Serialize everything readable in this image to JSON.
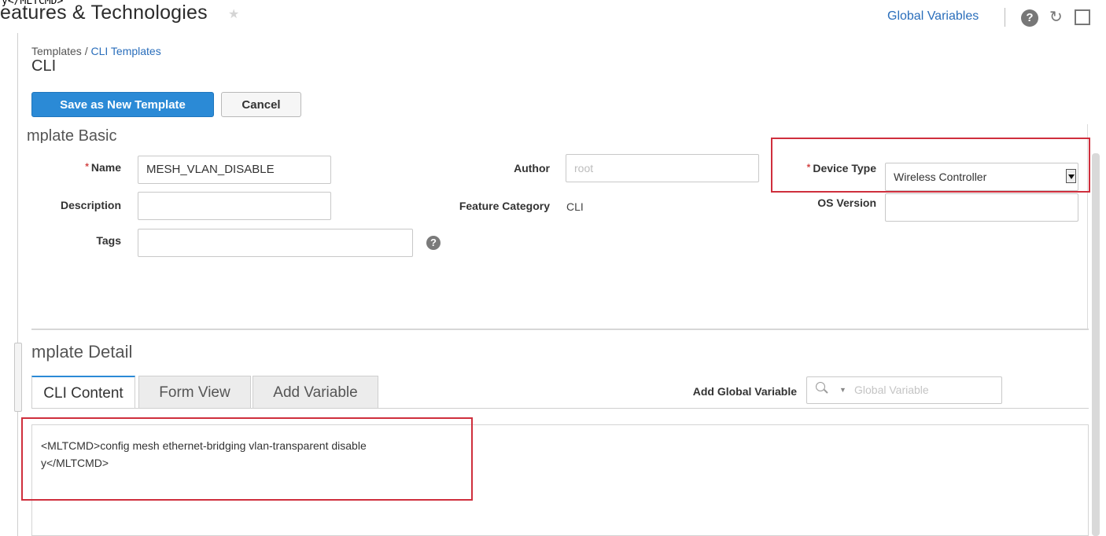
{
  "overlay": {
    "stray_text": "y</MLTCMD>"
  },
  "header": {
    "title": "eatures & Technologies",
    "star_icon": "star-icon",
    "global_variables_link": "Global Variables",
    "help_icon": "?",
    "refresh_icon": "refresh-icon",
    "layout_icon": "layout-icon"
  },
  "breadcrumb": {
    "root": "Templates",
    "separator": " / ",
    "current": "CLI Templates"
  },
  "page_title": "CLI",
  "toolbar": {
    "save_label": "Save as New Template",
    "cancel_label": "Cancel"
  },
  "template_basic": {
    "heading": "mplate Basic",
    "required_marker": "*",
    "name_label": "Name",
    "name_value": "MESH_VLAN_DISABLE",
    "description_label": "Description",
    "description_value": "",
    "tags_label": "Tags",
    "tags_value": "",
    "tags_help_icon": "?",
    "author_label": "Author",
    "author_placeholder": "root",
    "feature_category_label": "Feature Category",
    "feature_category_value": "CLI",
    "device_type_label": "Device Type",
    "device_type_value": "Wireless Controller",
    "os_version_label": "OS Version",
    "os_version_value": ""
  },
  "template_detail": {
    "heading": "mplate Detail",
    "tabs": [
      {
        "label": "CLI Content",
        "active": true
      },
      {
        "label": "Form View",
        "active": false
      },
      {
        "label": "Add Variable",
        "active": false
      }
    ],
    "add_global_variable_label": "Add Global Variable",
    "global_variable_placeholder": "Global Variable",
    "cli_content": "<MLTCMD>config mesh ethernet-bridging vlan-transparent disable\ny</MLTCMD>"
  },
  "colors": {
    "accent": "#2b8ad6",
    "link": "#2a6ebb",
    "highlight": "#cf2f3d",
    "required": "#d24343"
  }
}
